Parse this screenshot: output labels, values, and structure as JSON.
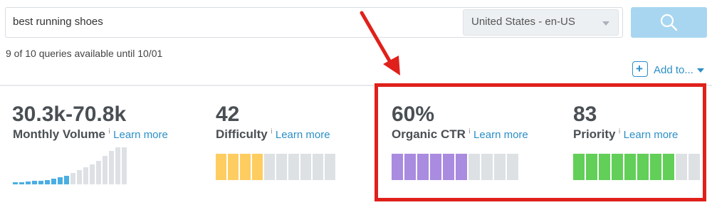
{
  "search": {
    "query": "best running shoes",
    "locale": "United States - en-US"
  },
  "quota_text": "9 of 10 queries available until 10/01",
  "add_to_label": "Add to...",
  "metrics": [
    {
      "value": "30.3k-70.8k",
      "label": "Monthly Volume",
      "link": "Learn more"
    },
    {
      "value": "42",
      "label": "Difficulty",
      "link": "Learn more",
      "level": 42
    },
    {
      "value": "60%",
      "label": "Organic CTR",
      "link": "Learn more",
      "level": 60
    },
    {
      "value": "83",
      "label": "Priority",
      "link": "Learn more",
      "level": 83
    }
  ],
  "info_glyph": "i",
  "volume_levels": [
    0.05,
    0.06,
    0.07,
    0.09,
    0.1,
    0.12,
    0.15,
    0.19,
    0.24,
    0.3,
    0.38,
    0.46,
    0.54,
    0.64,
    0.76,
    0.9,
    1.0,
    1.0
  ],
  "colors": {
    "accent": "#2b8fc7",
    "difficulty": "#fecd61",
    "ctr": "#a98be0",
    "priority": "#62cf58",
    "volume_fill": "#4aaee3",
    "empty": "#dde1e4",
    "highlight": "#e0201b"
  },
  "icons": [
    "search-icon",
    "plus-icon",
    "chevron-down-icon",
    "info-icon",
    "arrow-annotation"
  ]
}
